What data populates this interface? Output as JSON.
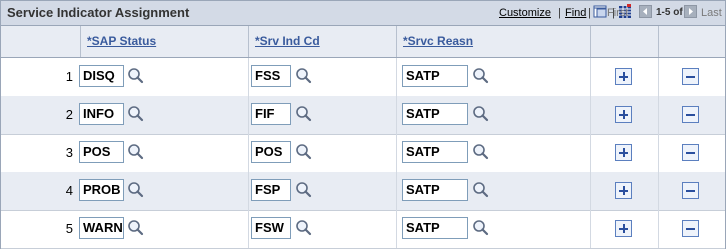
{
  "grid": {
    "title": "Service Indicator Assignment",
    "toolbar": {
      "customize_label": "Customize",
      "find_label": "Find",
      "separator": "|",
      "first_label": "First",
      "range_label": "1-5 of 5",
      "last_label": "Last"
    },
    "columns": [
      {
        "label": "*SAP Status"
      },
      {
        "label": "*Srv Ind Cd"
      },
      {
        "label": "*Srvc Reasn"
      }
    ],
    "rows": [
      {
        "num": "1",
        "sap_status": "DISQ",
        "srv_ind_cd": "FSS",
        "srvc_reasn": "SATP"
      },
      {
        "num": "2",
        "sap_status": "INFO",
        "srv_ind_cd": "FIF",
        "srvc_reasn": "SATP"
      },
      {
        "num": "3",
        "sap_status": "POS",
        "srv_ind_cd": "POS",
        "srvc_reasn": "SATP"
      },
      {
        "num": "4",
        "sap_status": "PROB",
        "srv_ind_cd": "FSP",
        "srvc_reasn": "SATP"
      },
      {
        "num": "5",
        "sap_status": "WARN",
        "srv_ind_cd": "FSW",
        "srvc_reasn": "SATP"
      }
    ],
    "icons": {
      "lookup": "magnifier-icon",
      "add": "plus-icon",
      "delete": "minus-icon",
      "view_all": "view-all-icon",
      "download": "spreadsheet-icon"
    },
    "colors": {
      "title_bar": "#d3dae6",
      "header_link": "#3a5b9d",
      "alt_row": "#e8ecf3",
      "border": "#9aa6b8"
    }
  }
}
